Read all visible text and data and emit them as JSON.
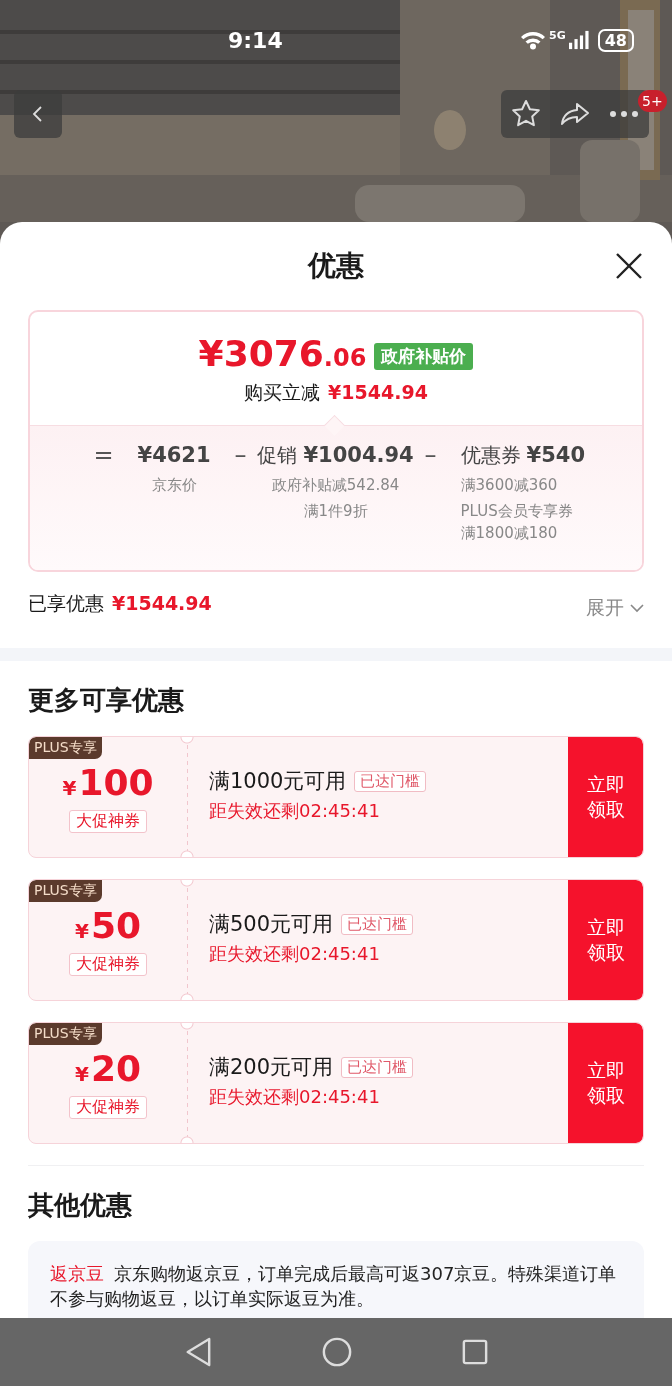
{
  "status_bar": {
    "time": "9:14",
    "network": "5G",
    "battery": "48"
  },
  "header": {
    "badge": "5+"
  },
  "sheet": {
    "title": "优惠"
  },
  "price_card": {
    "price_main": "¥3076",
    "price_decimal": ".06",
    "price_tag": "政府补贴价",
    "discount_label": "购买立减",
    "discount_value": "¥1544.94",
    "breakdown": [
      {
        "operator": "=",
        "amount": "¥4621",
        "notes": [
          "京东价"
        ]
      },
      {
        "operator": "–",
        "prefix": "促销",
        "amount": "¥1004.94",
        "notes": [
          "政府补贴减542.84",
          "满1件9折"
        ]
      },
      {
        "operator": "–",
        "prefix": "优惠券",
        "amount": "¥540",
        "notes": [
          "满3600减360",
          "PLUS会员专享券满1800减180"
        ]
      }
    ]
  },
  "savings": {
    "label": "已享优惠",
    "value": "¥1544.94",
    "expand": "展开"
  },
  "more_offers": {
    "title": "更多可享优惠",
    "coupons": [
      {
        "badge": "PLUS专享",
        "currency": "¥",
        "amount": "100",
        "tag": "大促神券",
        "condition": "满1000元可用",
        "status": "已达门槛",
        "countdown": "距失效还剩02:45:41",
        "button": "立即领取"
      },
      {
        "badge": "PLUS专享",
        "currency": "¥",
        "amount": "50",
        "tag": "大促神券",
        "condition": "满500元可用",
        "status": "已达门槛",
        "countdown": "距失效还剩02:45:41",
        "button": "立即领取"
      },
      {
        "badge": "PLUS专享",
        "currency": "¥",
        "amount": "20",
        "tag": "大促神券",
        "condition": "满200元可用",
        "status": "已达门槛",
        "countdown": "距失效还剩02:45:41",
        "button": "立即领取"
      }
    ]
  },
  "other_offers": {
    "title": "其他优惠",
    "items": [
      {
        "label": "返京豆",
        "text": "京东购物返京豆，订单完成后最高可返307京豆。特殊渠道订单不参与购物返豆，以订单实际返豆为准。"
      }
    ]
  }
}
